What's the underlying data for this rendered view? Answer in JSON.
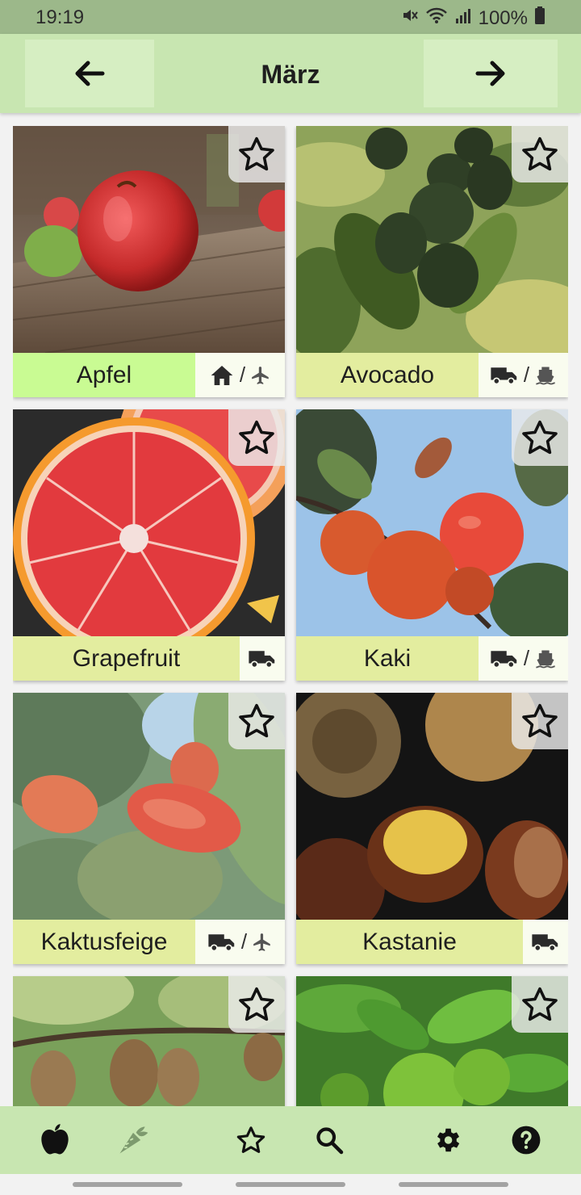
{
  "status": {
    "time": "19:19",
    "battery": "100%"
  },
  "header": {
    "title": "März",
    "prev_icon": "arrow-left-icon",
    "next_icon": "arrow-right-icon"
  },
  "items": [
    {
      "name": "Apfel",
      "origin": [
        "home-icon",
        "plane-icon"
      ],
      "highlight": true
    },
    {
      "name": "Avocado",
      "origin": [
        "truck-icon",
        "ship-icon"
      ],
      "highlight": false
    },
    {
      "name": "Grapefruit",
      "origin": [
        "truck-icon"
      ],
      "highlight": false
    },
    {
      "name": "Kaki",
      "origin": [
        "truck-icon",
        "ship-icon"
      ],
      "highlight": false
    },
    {
      "name": "Kaktusfeige",
      "origin": [
        "truck-icon",
        "plane-icon"
      ],
      "highlight": false
    },
    {
      "name": "Kastanie",
      "origin": [
        "truck-icon"
      ],
      "highlight": false
    }
  ],
  "origin_separator": "/",
  "bottom_nav": [
    "apple-icon",
    "carrot-icon",
    "star-icon",
    "search-icon",
    "gear-icon",
    "help-icon"
  ],
  "colors": {
    "header": "#c8e6b1",
    "label": "#e3ed9f",
    "label_highlight": "#c9fb93",
    "status_bar": "#9cb88a"
  }
}
